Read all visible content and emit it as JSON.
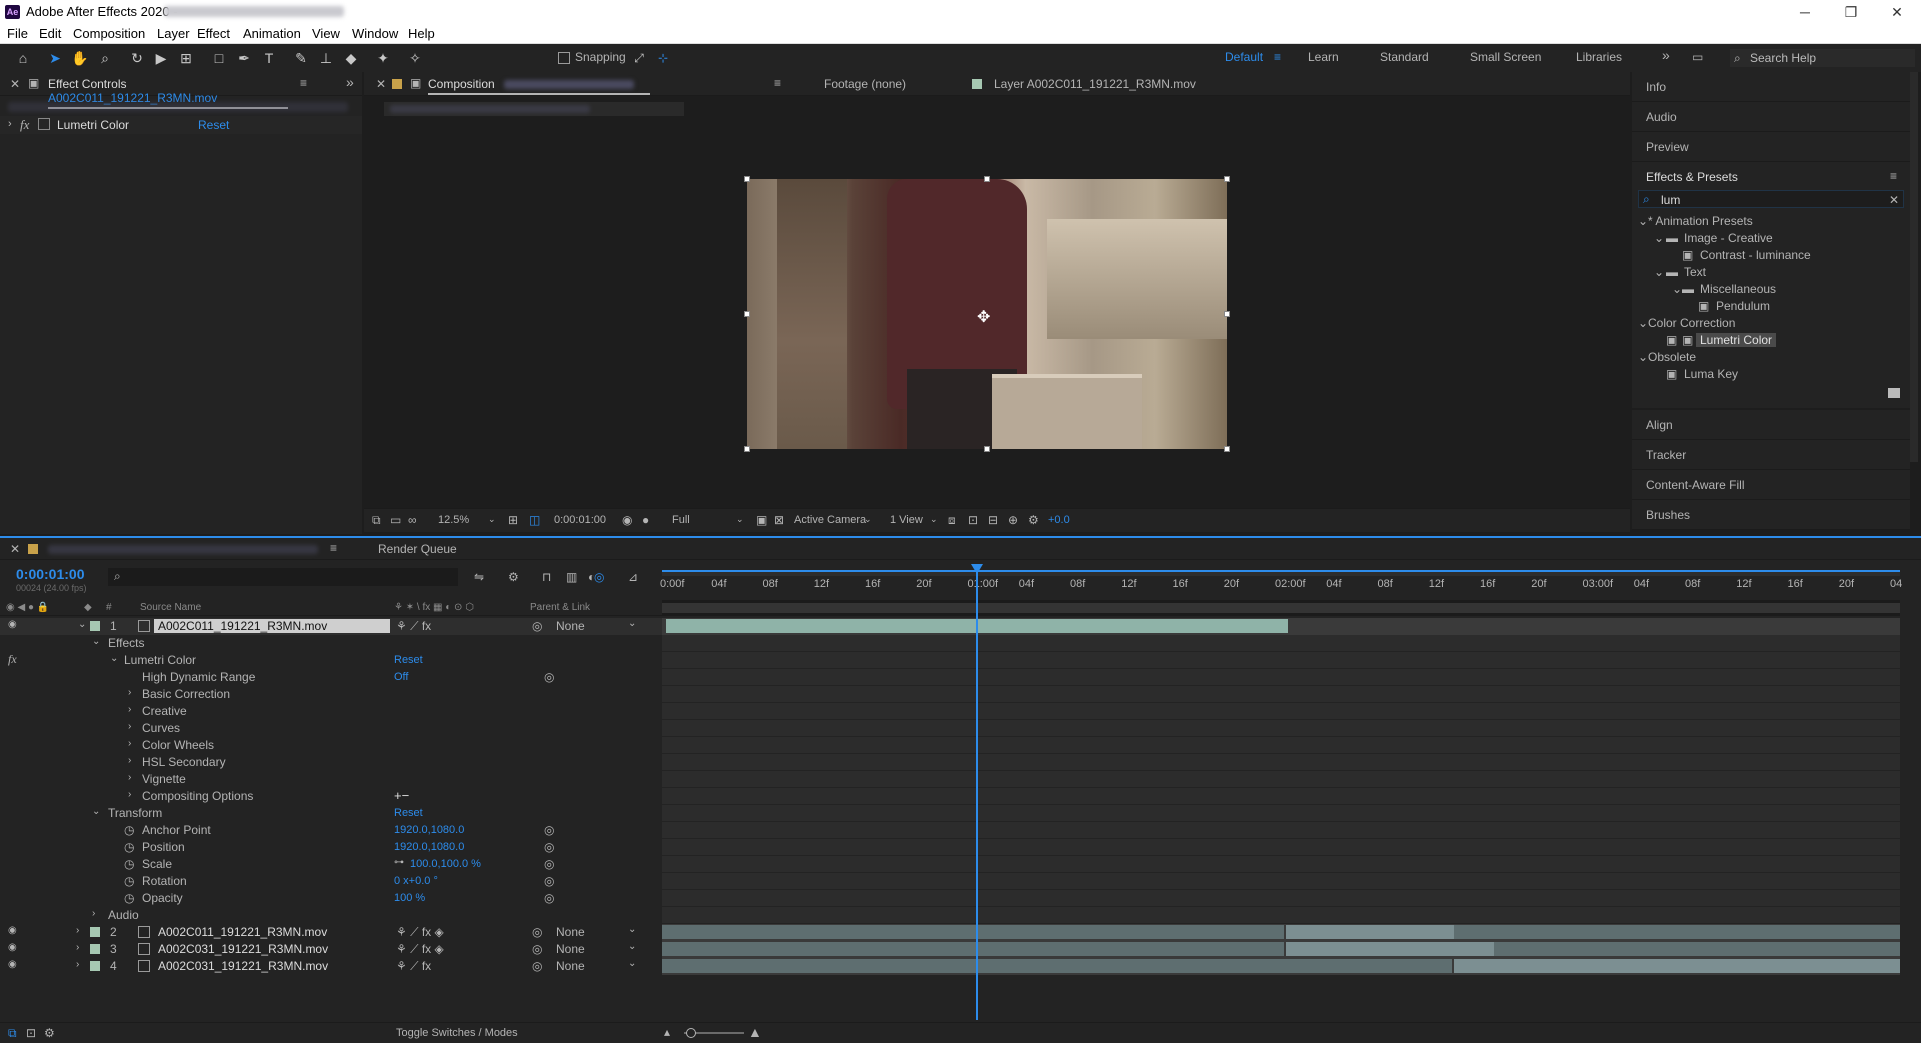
{
  "titlebar": {
    "app_title": "Adobe After Effects 2020 - ",
    "app_badge": "Ae",
    "minimize": "─",
    "restore": "❐",
    "close": "✕"
  },
  "menu": [
    "File",
    "Edit",
    "Composition",
    "Layer",
    "Effect",
    "Animation",
    "View",
    "Window",
    "Help"
  ],
  "toolbar": {
    "snapping": "Snapping"
  },
  "workspaces": {
    "items": [
      "Default",
      "Learn",
      "Standard",
      "Small Screen",
      "Libraries"
    ],
    "more": "»",
    "search_help": "Search Help"
  },
  "effect_controls": {
    "tab_prefix": "Effect Controls",
    "tab_file": "A002C011_191221_R3MN.mov",
    "effect_name": "Lumetri Color",
    "reset": "Reset"
  },
  "viewer": {
    "tab_composition": "Composition",
    "tab_footage": "Footage (none)",
    "tab_layer": "Layer A002C011_191221_R3MN.mov",
    "zoom": "12.5%",
    "timecode": "0:00:01:00",
    "resolution": "Full",
    "camera": "Active Camera",
    "views": "1 View",
    "exposure": "+0.0"
  },
  "right_panels": {
    "top": [
      "Info",
      "Audio",
      "Preview"
    ],
    "effects_presets_title": "Effects & Presets",
    "search_value": "lum",
    "tree": [
      {
        "label": "* Animation Presets",
        "level": 0,
        "type": "group"
      },
      {
        "label": "Image - Creative",
        "level": 1,
        "type": "folder"
      },
      {
        "label": "Contrast - luminance",
        "level": 2,
        "type": "preset"
      },
      {
        "label": "Text",
        "level": 1,
        "type": "folder"
      },
      {
        "label": "Miscellaneous",
        "level": 2,
        "type": "folder"
      },
      {
        "label": "Pendulum",
        "level": 3,
        "type": "preset"
      },
      {
        "label": "Color Correction",
        "level": 0,
        "type": "group"
      },
      {
        "label": "Lumetri Color",
        "level": 1,
        "type": "effect",
        "selected": true
      },
      {
        "label": "Obsolete",
        "level": 0,
        "type": "group"
      },
      {
        "label": "Luma Key",
        "level": 1,
        "type": "effect"
      }
    ],
    "bottom": [
      "Align",
      "Tracker",
      "Content-Aware Fill",
      "Brushes"
    ]
  },
  "timeline": {
    "render_queue": "Render Queue",
    "timecode": "0:00:01:00",
    "frame_info": "00024 (24.00 fps)",
    "columns": {
      "source_name": "Source Name",
      "parent": "Parent & Link"
    },
    "ruler": [
      "0:00f",
      "04f",
      "08f",
      "12f",
      "16f",
      "20f",
      "01:00f",
      "04f",
      "08f",
      "12f",
      "16f",
      "20f",
      "02:00f",
      "04f",
      "08f",
      "12f",
      "16f",
      "20f",
      "03:00f",
      "04f",
      "08f",
      "12f",
      "16f",
      "20f",
      "04"
    ],
    "layer1": {
      "num": "1",
      "name": "A002C011_191221_R3MN.mov",
      "parent": "None"
    },
    "effects_label": "Effects",
    "lumetri": {
      "label": "Lumetri Color",
      "reset": "Reset"
    },
    "hdr": {
      "label": "High Dynamic Range",
      "value": "Off"
    },
    "sub_groups": [
      "Basic Correction",
      "Creative",
      "Curves",
      "Color Wheels",
      "HSL Secondary",
      "Vignette",
      "Compositing Options"
    ],
    "compositing_value": "+−",
    "transform": {
      "label": "Transform",
      "reset": "Reset"
    },
    "props": [
      {
        "label": "Anchor Point",
        "value": "1920.0,1080.0"
      },
      {
        "label": "Position",
        "value": "1920.0,1080.0"
      },
      {
        "label": "Scale",
        "value": "100.0,100.0 %"
      },
      {
        "label": "Rotation",
        "value": "0 x+0.0 °"
      },
      {
        "label": "Opacity",
        "value": "100 %"
      }
    ],
    "audio_label": "Audio",
    "other_layers": [
      {
        "num": "2",
        "name": "A002C011_191221_R3MN.mov",
        "parent": "None"
      },
      {
        "num": "3",
        "name": "A002C031_191221_R3MN.mov",
        "parent": "None"
      },
      {
        "num": "4",
        "name": "A002C031_191221_R3MN.mov",
        "parent": "None"
      }
    ],
    "toggle": "Toggle Switches / Modes"
  }
}
